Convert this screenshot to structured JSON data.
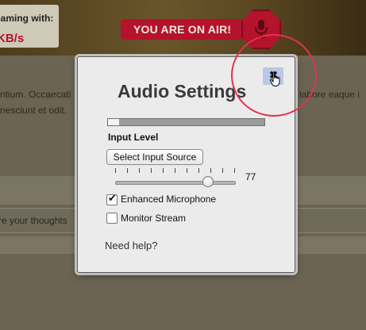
{
  "header": {
    "stream_label": "eaming with:",
    "stream_rate": "KB/s",
    "onair_text": "YOU ARE ON AIR!",
    "mic_icon": "microphone-icon",
    "accent_color": "#b5132b"
  },
  "content": {
    "text_line1_left": "ntium. Occaecati",
    "text_line1_right": "n labore eaque i",
    "text_line2_left": " nesciunt et odit.",
    "comment_placeholder": "re your thoughts"
  },
  "dialog": {
    "title": "Audio Settings",
    "close_label": "✖",
    "close_icon": "close-icon",
    "cursor_icon": "hand-pointer-icon",
    "input_level_label": "Input Level",
    "input_level_fraction": 0.07,
    "select_source_label": "Select Input Source",
    "slider": {
      "value": "77",
      "min": 0,
      "max": 100,
      "ticks": 11
    },
    "enhanced_mic": {
      "label": "Enhanced Microphone",
      "checked": true
    },
    "monitor_stream": {
      "label": "Monitor Stream",
      "checked": false
    },
    "help_label": "Need help?"
  }
}
